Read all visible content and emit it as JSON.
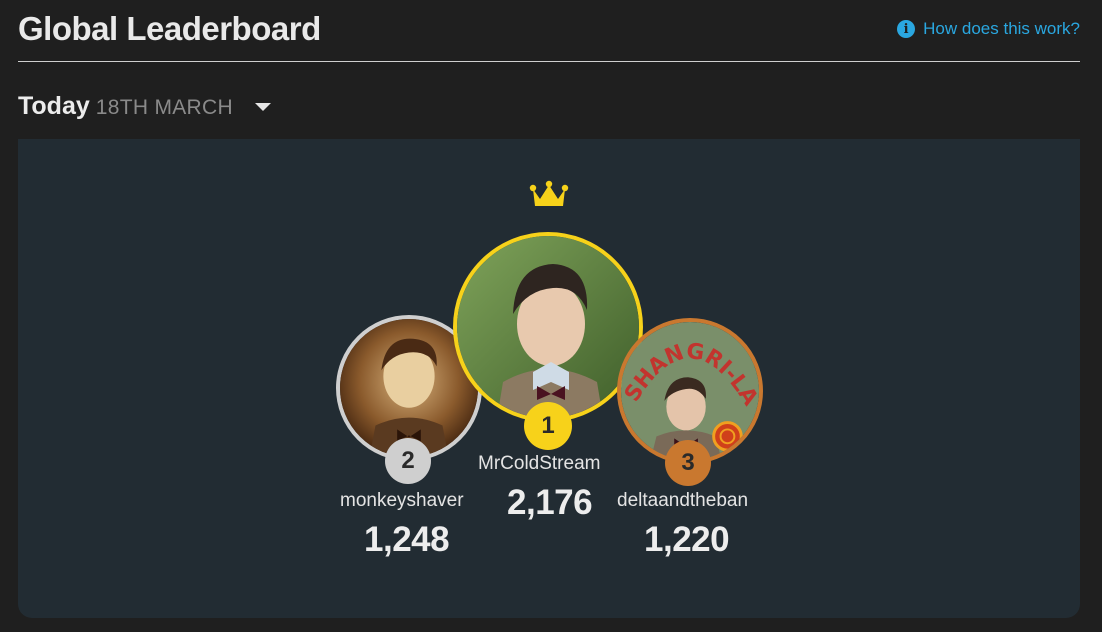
{
  "header": {
    "title": "Global Leaderboard",
    "help_label": "How does this work?",
    "help_icon": "info-icon"
  },
  "period": {
    "label": "Today",
    "date": "18TH MARCH",
    "dropdown_icon": "chevron-down-icon"
  },
  "podium": {
    "first": {
      "rank": "1",
      "username": "MrColdStream",
      "score": "2,176",
      "ring_color": "#f7d21a"
    },
    "second": {
      "rank": "2",
      "username": "monkeyshaver",
      "score": "1,248",
      "ring_color": "#cfcfcf"
    },
    "third": {
      "rank": "3",
      "username": "deltaandtheban",
      "score": "1,220",
      "ring_color": "#c9782f"
    }
  },
  "colors": {
    "accent": "#2aa7e0",
    "gold": "#f7d21a",
    "silver": "#cfcfcf",
    "bronze": "#c9782f",
    "panel": "#222c33",
    "background": "#1f1f1f"
  },
  "third_avatar_sign_text": "SHANGRI-LA"
}
